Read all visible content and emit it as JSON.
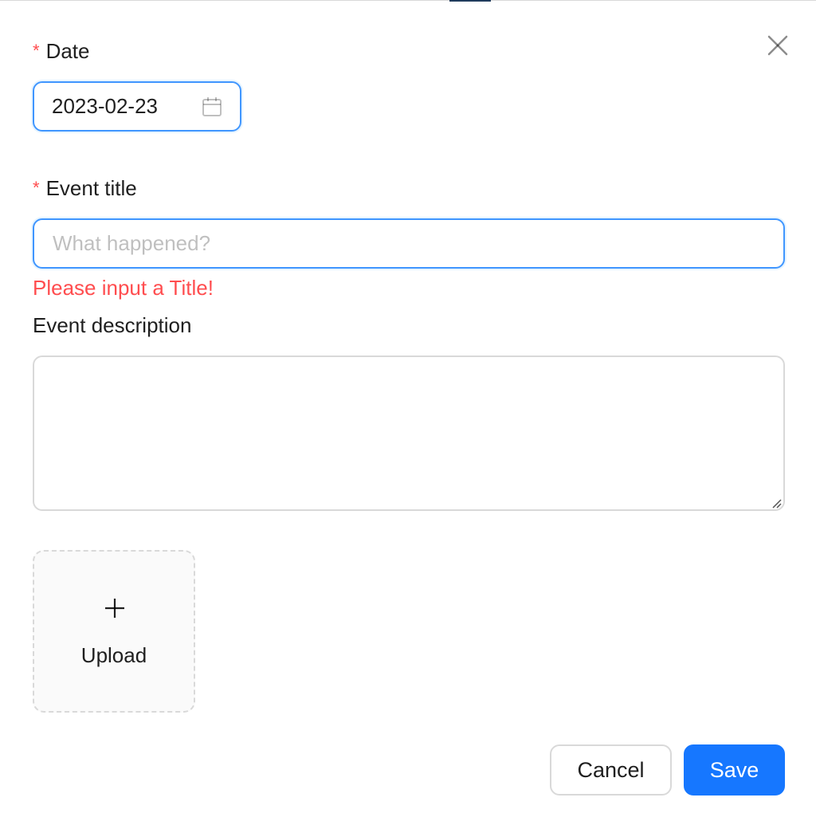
{
  "form": {
    "date": {
      "required_mark": "*",
      "label": "Date",
      "value": "2023-02-23"
    },
    "title": {
      "required_mark": "*",
      "label": "Event title",
      "value": "",
      "placeholder": "What happened?",
      "error": "Please input a Title!"
    },
    "description": {
      "label": "Event description",
      "value": ""
    },
    "upload": {
      "label": "Upload"
    }
  },
  "footer": {
    "cancel_label": "Cancel",
    "save_label": "Save"
  },
  "icons": {
    "close": "close-icon",
    "calendar": "calendar-icon",
    "plus": "plus-icon"
  },
  "colors": {
    "primary": "#1677ff",
    "focus_border": "#4096ff",
    "error": "#ff4d4f",
    "border": "#d9d9d9"
  }
}
